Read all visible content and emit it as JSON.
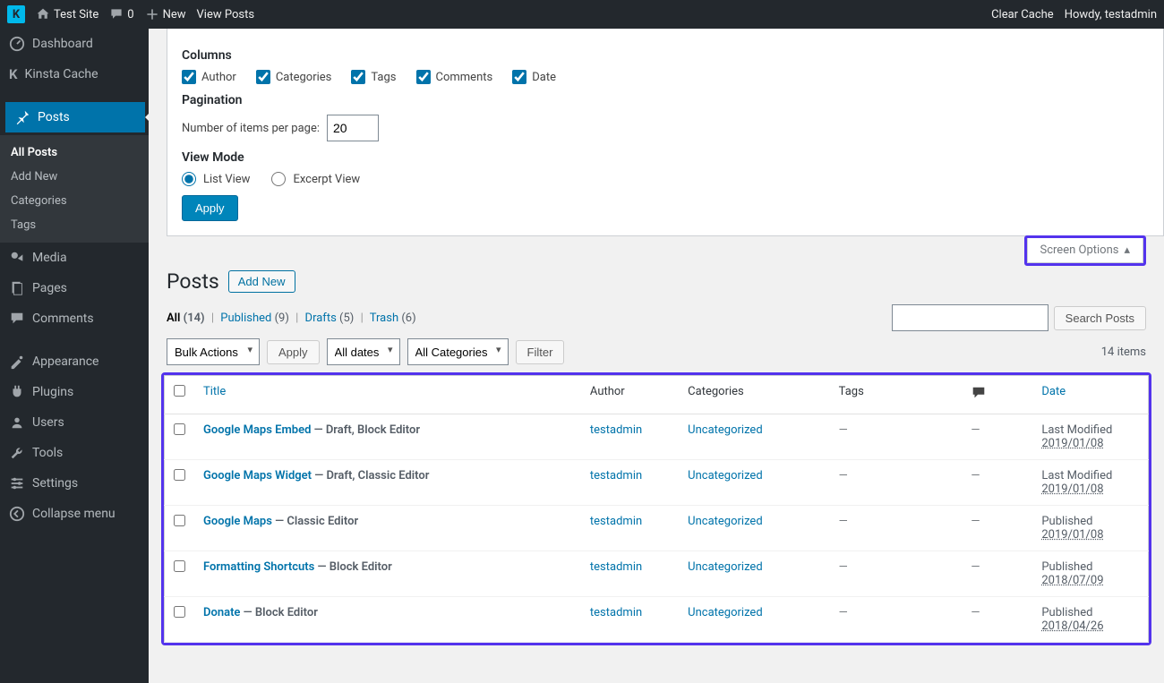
{
  "adminbar": {
    "site_name": "Test Site",
    "comments_count": "0",
    "new_label": "New",
    "view_posts": "View Posts",
    "clear_cache": "Clear Cache",
    "howdy": "Howdy, testadmin"
  },
  "sidebar": {
    "dashboard": "Dashboard",
    "kinsta_cache": "Kinsta Cache",
    "posts": "Posts",
    "sub": {
      "all_posts": "All Posts",
      "add_new": "Add New",
      "categories": "Categories",
      "tags": "Tags"
    },
    "media": "Media",
    "pages": "Pages",
    "comments": "Comments",
    "appearance": "Appearance",
    "plugins": "Plugins",
    "users": "Users",
    "tools": "Tools",
    "settings": "Settings",
    "collapse": "Collapse menu"
  },
  "screen_options": {
    "columns_heading": "Columns",
    "columns": {
      "author": "Author",
      "categories": "Categories",
      "tags": "Tags",
      "comments": "Comments",
      "date": "Date"
    },
    "pagination_heading": "Pagination",
    "per_page_label": "Number of items per page:",
    "per_page_value": "20",
    "view_mode_heading": "View Mode",
    "list_view": "List View",
    "excerpt_view": "Excerpt View",
    "apply": "Apply",
    "tab_label": "Screen Options"
  },
  "page": {
    "title": "Posts",
    "add_new": "Add New"
  },
  "filters": {
    "all": "All",
    "all_count": "(14)",
    "published": "Published",
    "published_count": "(9)",
    "drafts": "Drafts",
    "drafts_count": "(5)",
    "trash": "Trash",
    "trash_count": "(6)",
    "search_btn": "Search Posts",
    "bulk_actions": "Bulk Actions",
    "apply": "Apply",
    "all_dates": "All dates",
    "all_categories": "All Categories",
    "filter": "Filter",
    "item_count": "14 items"
  },
  "table": {
    "headers": {
      "title": "Title",
      "author": "Author",
      "categories": "Categories",
      "tags": "Tags",
      "date": "Date"
    },
    "rows": [
      {
        "title": "Google Maps Embed",
        "state": " — Draft, Block Editor",
        "author": "testadmin",
        "category": "Uncategorized",
        "tags": "—",
        "comments": "—",
        "date_status": "Last Modified",
        "date": "2019/01/08"
      },
      {
        "title": "Google Maps Widget",
        "state": " — Draft, Classic Editor",
        "author": "testadmin",
        "category": "Uncategorized",
        "tags": "—",
        "comments": "—",
        "date_status": "Last Modified",
        "date": "2019/01/08"
      },
      {
        "title": "Google Maps",
        "state": " — Classic Editor",
        "author": "testadmin",
        "category": "Uncategorized",
        "tags": "—",
        "comments": "—",
        "date_status": "Published",
        "date": "2019/01/08"
      },
      {
        "title": "Formatting Shortcuts",
        "state": " — Block Editor",
        "author": "testadmin",
        "category": "Uncategorized",
        "tags": "—",
        "comments": "—",
        "date_status": "Published",
        "date": "2018/07/09"
      },
      {
        "title": "Donate",
        "state": " — Block Editor",
        "author": "testadmin",
        "category": "Uncategorized",
        "tags": "—",
        "comments": "—",
        "date_status": "Published",
        "date": "2018/04/26"
      }
    ]
  }
}
